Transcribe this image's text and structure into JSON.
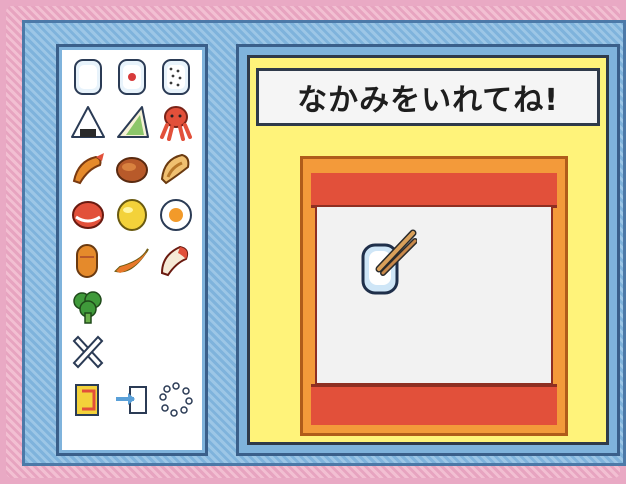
{
  "title": "なかみをいれてね!",
  "palette": {
    "items": [
      {
        "icon": "rice-white-icon"
      },
      {
        "icon": "rice-plum-icon"
      },
      {
        "icon": "rice-furikake-icon"
      },
      {
        "icon": "onigiri-icon"
      },
      {
        "icon": "sandwich-icon"
      },
      {
        "icon": "octopus-sausage-icon"
      },
      {
        "icon": "fried-shrimp-icon"
      },
      {
        "icon": "hamburg-steak-icon"
      },
      {
        "icon": "croquette-icon"
      },
      {
        "icon": "sausage-icon"
      },
      {
        "icon": "tamagoyaki-icon"
      },
      {
        "icon": "fried-egg-icon"
      },
      {
        "icon": "hot-dog-icon"
      },
      {
        "icon": "melon-slice-icon"
      },
      {
        "icon": "apple-rabbit-icon"
      },
      {
        "icon": "broccoli-icon"
      },
      {
        "icon": "empty-slot"
      },
      {
        "icon": "empty-slot"
      },
      {
        "icon": "cross-erase-icon"
      },
      {
        "icon": "empty-slot"
      },
      {
        "icon": "empty-slot"
      },
      {
        "icon": "undo-icon"
      },
      {
        "icon": "export-icon"
      },
      {
        "icon": "sparkle-icon"
      }
    ]
  },
  "lunchbox": {
    "held_item": "rice-with-chopsticks-icon"
  },
  "colors": {
    "frame_pink": "#e9a9c4",
    "frame_blue": "#7fb3dc",
    "panel_yellow": "#fff37a",
    "lunchbox_orange": "#f39a3a",
    "lunchbox_red": "#e2503a"
  }
}
